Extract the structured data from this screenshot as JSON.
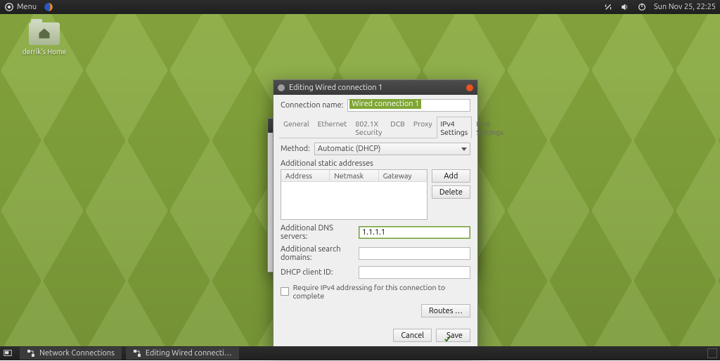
{
  "panel": {
    "menu_label": "Menu",
    "clock": "Sun Nov 25, 22:25"
  },
  "desktop_icon": {
    "label": "derrik's Home"
  },
  "taskbar": {
    "items": [
      "Network Connections",
      "Editing Wired connecti…"
    ]
  },
  "dialog": {
    "title": "Editing Wired connection 1",
    "connection_name_label": "Connection name:",
    "connection_name_value": "Wired connection 1",
    "tabs": [
      "General",
      "Ethernet",
      "802.1X Security",
      "DCB",
      "Proxy",
      "IPv4 Settings",
      "IPv6 Settings"
    ],
    "active_tab_index": 5,
    "method_label": "Method:",
    "method_value": "Automatic (DHCP)",
    "addresses_section": "Additional static addresses",
    "addr_cols": [
      "Address",
      "Netmask",
      "Gateway"
    ],
    "add_btn": "Add",
    "delete_btn": "Delete",
    "dns_label": "Additional DNS servers:",
    "dns_value": "1.1.1.1",
    "search_label": "Additional search domains:",
    "search_value": "",
    "dhcp_label": "DHCP client ID:",
    "dhcp_value": "",
    "require_label": "Require IPv4 addressing for this connection to complete",
    "routes_btn": "Routes …",
    "cancel_btn": "Cancel",
    "save_btn": "Save"
  }
}
